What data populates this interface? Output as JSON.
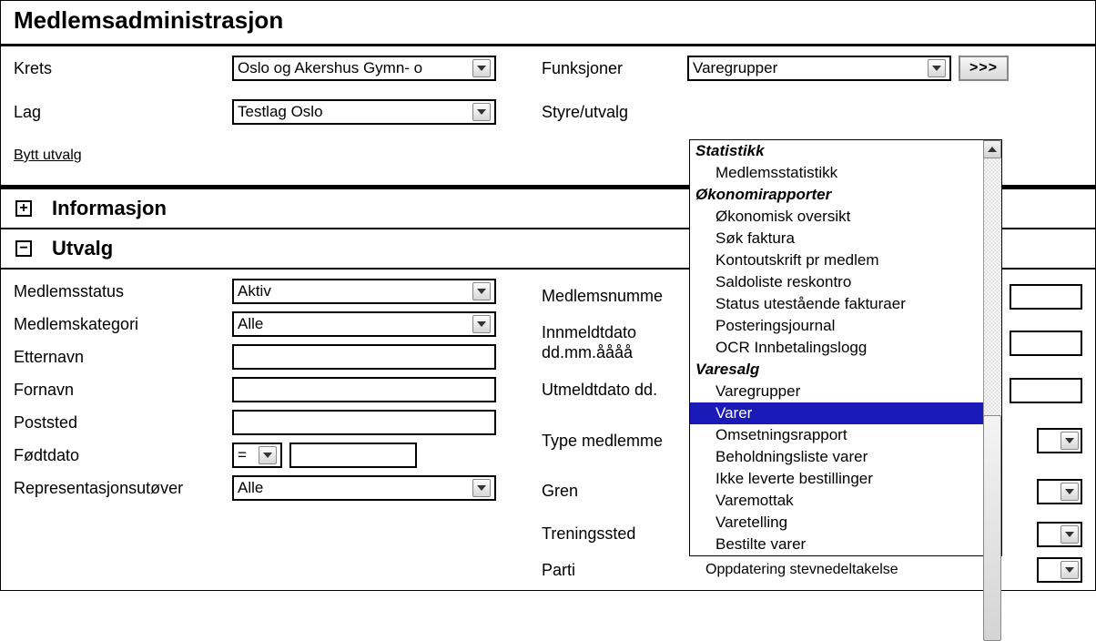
{
  "page_title": "Medlemsadministrasjon",
  "top": {
    "krets_label": "Krets",
    "krets_value": "Oslo og Akershus Gymn- o",
    "lag_label": "Lag",
    "lag_value": "Testlag Oslo",
    "bytt_label": "Bytt utvalg",
    "funksjoner_label": "Funksjoner",
    "funksjoner_value": "Varegrupper",
    "go_label": ">>>",
    "styre_label": "Styre/utvalg"
  },
  "acc1_label": "Informasjon",
  "acc2_label": "Utvalg",
  "utvalg": {
    "medlemsstatus_label": "Medlemsstatus",
    "medlemsstatus_value": "Aktiv",
    "medlemskategori_label": "Medlemskategori",
    "medlemskategori_value": "Alle",
    "etternavn_label": "Etternavn",
    "fornavn_label": "Fornavn",
    "poststed_label": "Poststed",
    "fodtdato_label": "Fødtdato",
    "fodtdato_op": "=",
    "rep_label": "Representasjonsutøver",
    "rep_value": "Alle",
    "medlemsnummer_label": "Medlemsnumme",
    "innmeldt_label": "Innmeldtdato dd.mm.åååå",
    "utmeldt_label": "Utmeldtdato dd.",
    "typemedlem_label": "Type medlemme",
    "gren_label": "Gren",
    "treningssted_label": "Treningssted",
    "parti_label": "Parti",
    "oppdatering_text": "Oppdatering stevnedeltakelse"
  },
  "listbox": {
    "groups": [
      {
        "head": "Statistikk",
        "items": [
          "Medlemsstatistikk"
        ]
      },
      {
        "head": "Økonomirapporter",
        "items": [
          "Økonomisk oversikt",
          "Søk faktura",
          "Kontoutskrift pr medlem",
          "Saldoliste reskontro",
          "Status utestående fakturaer",
          "Posteringsjournal",
          "OCR Innbetalingslogg"
        ]
      },
      {
        "head": "Varesalg",
        "items": [
          "Varegrupper",
          "Varer",
          "Omsetningsrapport",
          "Beholdningsliste varer",
          "Ikke leverte bestillinger",
          "Varemottak",
          "Varetelling",
          "Bestilte varer"
        ]
      }
    ],
    "selected": "Varer"
  }
}
